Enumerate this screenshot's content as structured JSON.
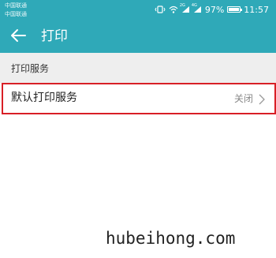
{
  "status_bar": {
    "carrier_1": "中国联通",
    "carrier_2": "中国联通",
    "network_tag_1": "2G",
    "network_tag_2": "4G",
    "battery_percent": "97%",
    "time": "11:57",
    "icons": [
      "vibrate-icon",
      "wifi-icon",
      "signal-icon",
      "signal-icon",
      "battery-icon"
    ]
  },
  "app_bar": {
    "title": "打印",
    "back_icon": "arrow-left-icon"
  },
  "section": {
    "title": "打印服务"
  },
  "list": {
    "items": [
      {
        "label": "默认打印服务",
        "value": "关闭",
        "icon": "chevron-right-icon"
      }
    ]
  },
  "watermark": {
    "text": "hubeihong.com"
  },
  "colors": {
    "header": "#2fa9b8",
    "section_bg": "#eeeeee",
    "highlight": "#d81f26",
    "secondary_text": "#888888"
  }
}
